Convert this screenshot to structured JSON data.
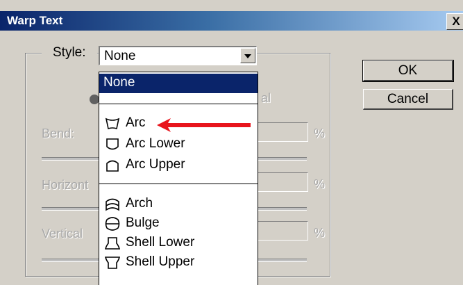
{
  "window": {
    "title": "Warp Text",
    "close_symbol": "X"
  },
  "style": {
    "label": "Style:",
    "selected": "None"
  },
  "buttons": {
    "ok": "OK",
    "cancel": "Cancel"
  },
  "background_controls": {
    "bend_label": "Bend:",
    "horizontal_label": "Horizont",
    "vertical_label": "Vertical",
    "percent": "%",
    "orientation_fragment": "al"
  },
  "dropdown": {
    "options": [
      {
        "label": "None",
        "icon": "none",
        "selected": true
      },
      {
        "label": "",
        "icon": "none",
        "selected": false
      },
      {
        "label": "Arc",
        "icon": "arc-icon",
        "selected": false
      },
      {
        "label": "Arc Lower",
        "icon": "arc-lower-icon",
        "selected": false
      },
      {
        "label": "Arc Upper",
        "icon": "arc-upper-icon",
        "selected": false
      },
      {
        "label": "Arch",
        "icon": "arch-icon",
        "selected": false
      },
      {
        "label": "Bulge",
        "icon": "bulge-icon",
        "selected": false
      },
      {
        "label": "Shell Lower",
        "icon": "shell-lower-icon",
        "selected": false
      },
      {
        "label": "Shell Upper",
        "icon": "shell-upper-icon",
        "selected": false
      }
    ]
  },
  "annotation": {
    "arrow_color": "#e8141c",
    "points_to": "Arc"
  },
  "colors": {
    "titlebar_start": "#0a246a",
    "titlebar_end": "#a6caf0",
    "dialog_bg": "#d4d0c8",
    "selection_bg": "#0a246a"
  }
}
